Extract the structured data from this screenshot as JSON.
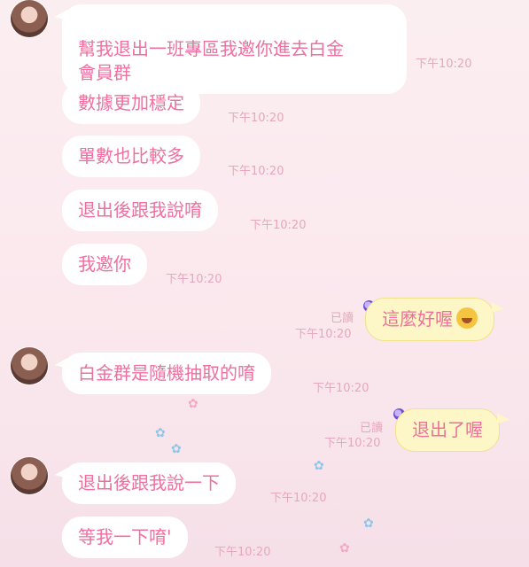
{
  "messages": [
    {
      "text": "幫我退出一班專區我邀你進去白金\n會員群",
      "time": "下午10:20"
    },
    {
      "text": "數據更加穩定",
      "time": "下午10:20"
    },
    {
      "text": "單數也比較多",
      "time": "下午10:20"
    },
    {
      "text": "退出後跟我說唷",
      "time": "下午10:20"
    },
    {
      "text": "我邀你",
      "time": "下午10:20"
    },
    {
      "text": "這麼好喔",
      "read": "已讀",
      "time": "下午10:20",
      "emoji": "rolling-on-floor-laughing-emoji"
    },
    {
      "text": "白金群是隨機抽取的唷",
      "time": "下午10:20"
    },
    {
      "text": "退出了喔",
      "read": "已讀",
      "time": "下午10:20"
    },
    {
      "text": "退出後跟我說一下",
      "time": "下午10:20"
    },
    {
      "text": "等我一下唷'",
      "time": "下午10:20"
    }
  ]
}
